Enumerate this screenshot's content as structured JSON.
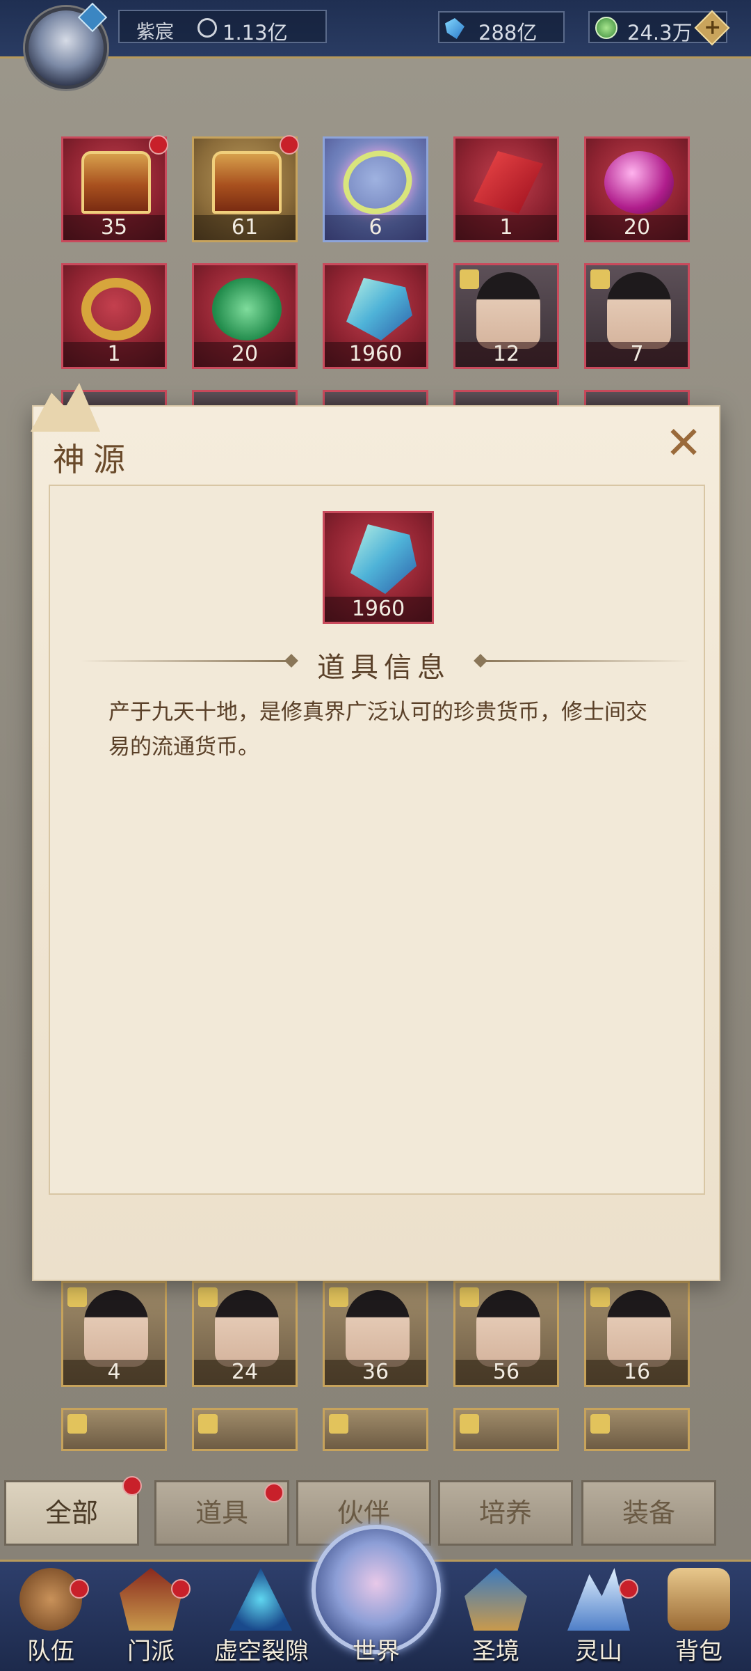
{
  "header": {
    "player_name": "紫宸",
    "power_value": "1.13亿",
    "gem_value": "288亿",
    "coin_value": "24.3万",
    "plus_label": "+"
  },
  "grid": {
    "row1": [
      {
        "icon": "treasure-chest-icon",
        "count": "35"
      },
      {
        "icon": "treasure-chest-icon",
        "count": "61"
      },
      {
        "icon": "ribbon-ornament-icon",
        "count": "6"
      },
      {
        "icon": "red-talisman-icon",
        "count": "1"
      },
      {
        "icon": "pink-orb-icon",
        "count": "20"
      }
    ],
    "row2": [
      {
        "icon": "ruby-ring-icon",
        "count": "1"
      },
      {
        "icon": "jade-disc-icon",
        "count": "20"
      },
      {
        "icon": "crystal-icon",
        "count": "1960"
      },
      {
        "icon": "hero-portrait-icon",
        "count": "12"
      },
      {
        "icon": "hero-portrait-icon",
        "count": "7"
      }
    ],
    "row9": [
      {
        "icon": "hero-portrait-icon",
        "count": "4"
      },
      {
        "icon": "hero-portrait-icon",
        "count": "24"
      },
      {
        "icon": "hero-portrait-icon",
        "count": "36"
      },
      {
        "icon": "hero-portrait-icon",
        "count": "56"
      },
      {
        "icon": "hero-portrait-icon",
        "count": "16"
      }
    ]
  },
  "dialog": {
    "title": "神源",
    "close_label": "✕",
    "item_count": "1960",
    "item_icon": "crystal-icon",
    "info_heading": "道具信息",
    "description": "产于九天十地，是修真界广泛认可的珍贵货币，修士间交易的流通货币。"
  },
  "tabs": [
    "全部",
    "道具",
    "伙伴",
    "培养",
    "装备"
  ],
  "nav": [
    "队伍",
    "门派",
    "虚空裂隙",
    "世界",
    "圣境",
    "灵山",
    "背包"
  ],
  "colors": {
    "topbar": "#1f2f52",
    "accent_gold": "#b79a5c",
    "slot_red": "#c94a5c",
    "badge_red": "#c8202a",
    "dialog_bg": "#f5ecdc"
  }
}
